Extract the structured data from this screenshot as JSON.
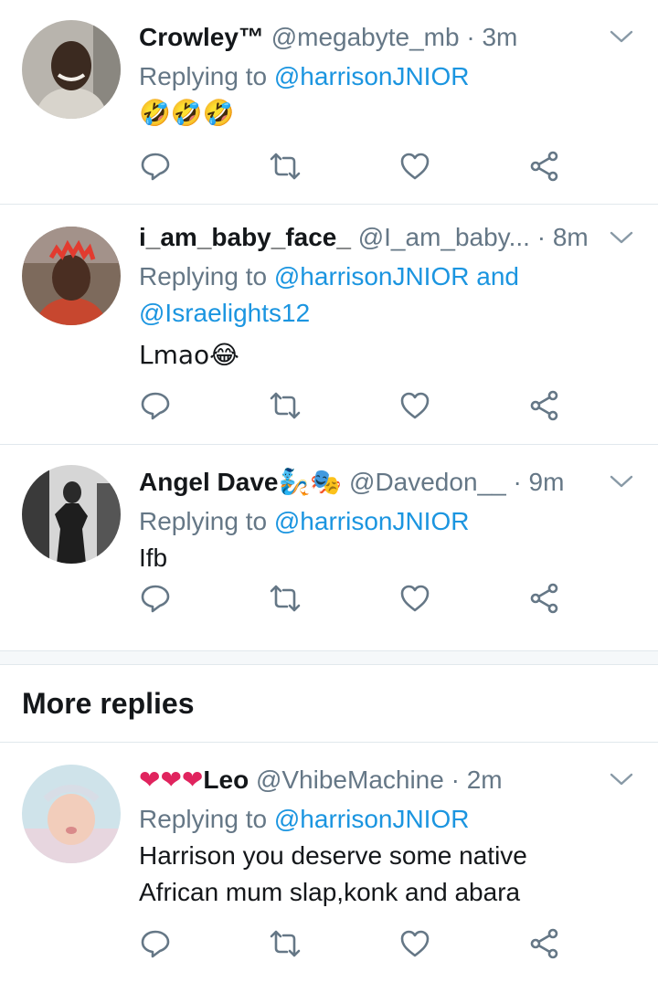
{
  "tweets_top": [
    {
      "display_name": "Crowley™",
      "handle": "@megabyte_mb",
      "time": "· 3m",
      "reply_prefix": "Replying to ",
      "reply_to": "@harrisonJNIOR",
      "reply_to_2": "",
      "reply_and": "",
      "text": "🤣🤣🤣"
    },
    {
      "display_name": "i_am_baby_face_",
      "handle": "@I_am_baby...",
      "time": "· 8m",
      "reply_prefix": "Replying to ",
      "reply_to": "@harrisonJNIOR",
      "reply_and": " and",
      "reply_to_2": "@Israelights12",
      "text": "Lmao😂"
    },
    {
      "display_name": "Angel Dave",
      "name_emoji": "🧞🎭",
      "handle": "@Davedon__",
      "time": "· 9m",
      "reply_prefix": "Replying to ",
      "reply_to": "@harrisonJNIOR",
      "text": "Ifb"
    }
  ],
  "section": {
    "title": "More replies"
  },
  "tweet_more": {
    "name_prefix": "❤❤❤",
    "display_name": "Leo",
    "handle": "@VhibeMachine",
    "time": "· 2m",
    "reply_prefix": "Replying to ",
    "reply_to": "@harrisonJNIOR",
    "text_line1": "Harrison you deserve some native",
    "text_line2": "African mum slap,konk and abara"
  },
  "icons": [
    "reply-icon",
    "retweet-icon",
    "like-icon",
    "share-icon",
    "chevron-down-icon"
  ],
  "colors": {
    "link": "#1b95e0",
    "muted": "#657786",
    "divider": "#e1e8ed",
    "heart": "#e0245e"
  }
}
